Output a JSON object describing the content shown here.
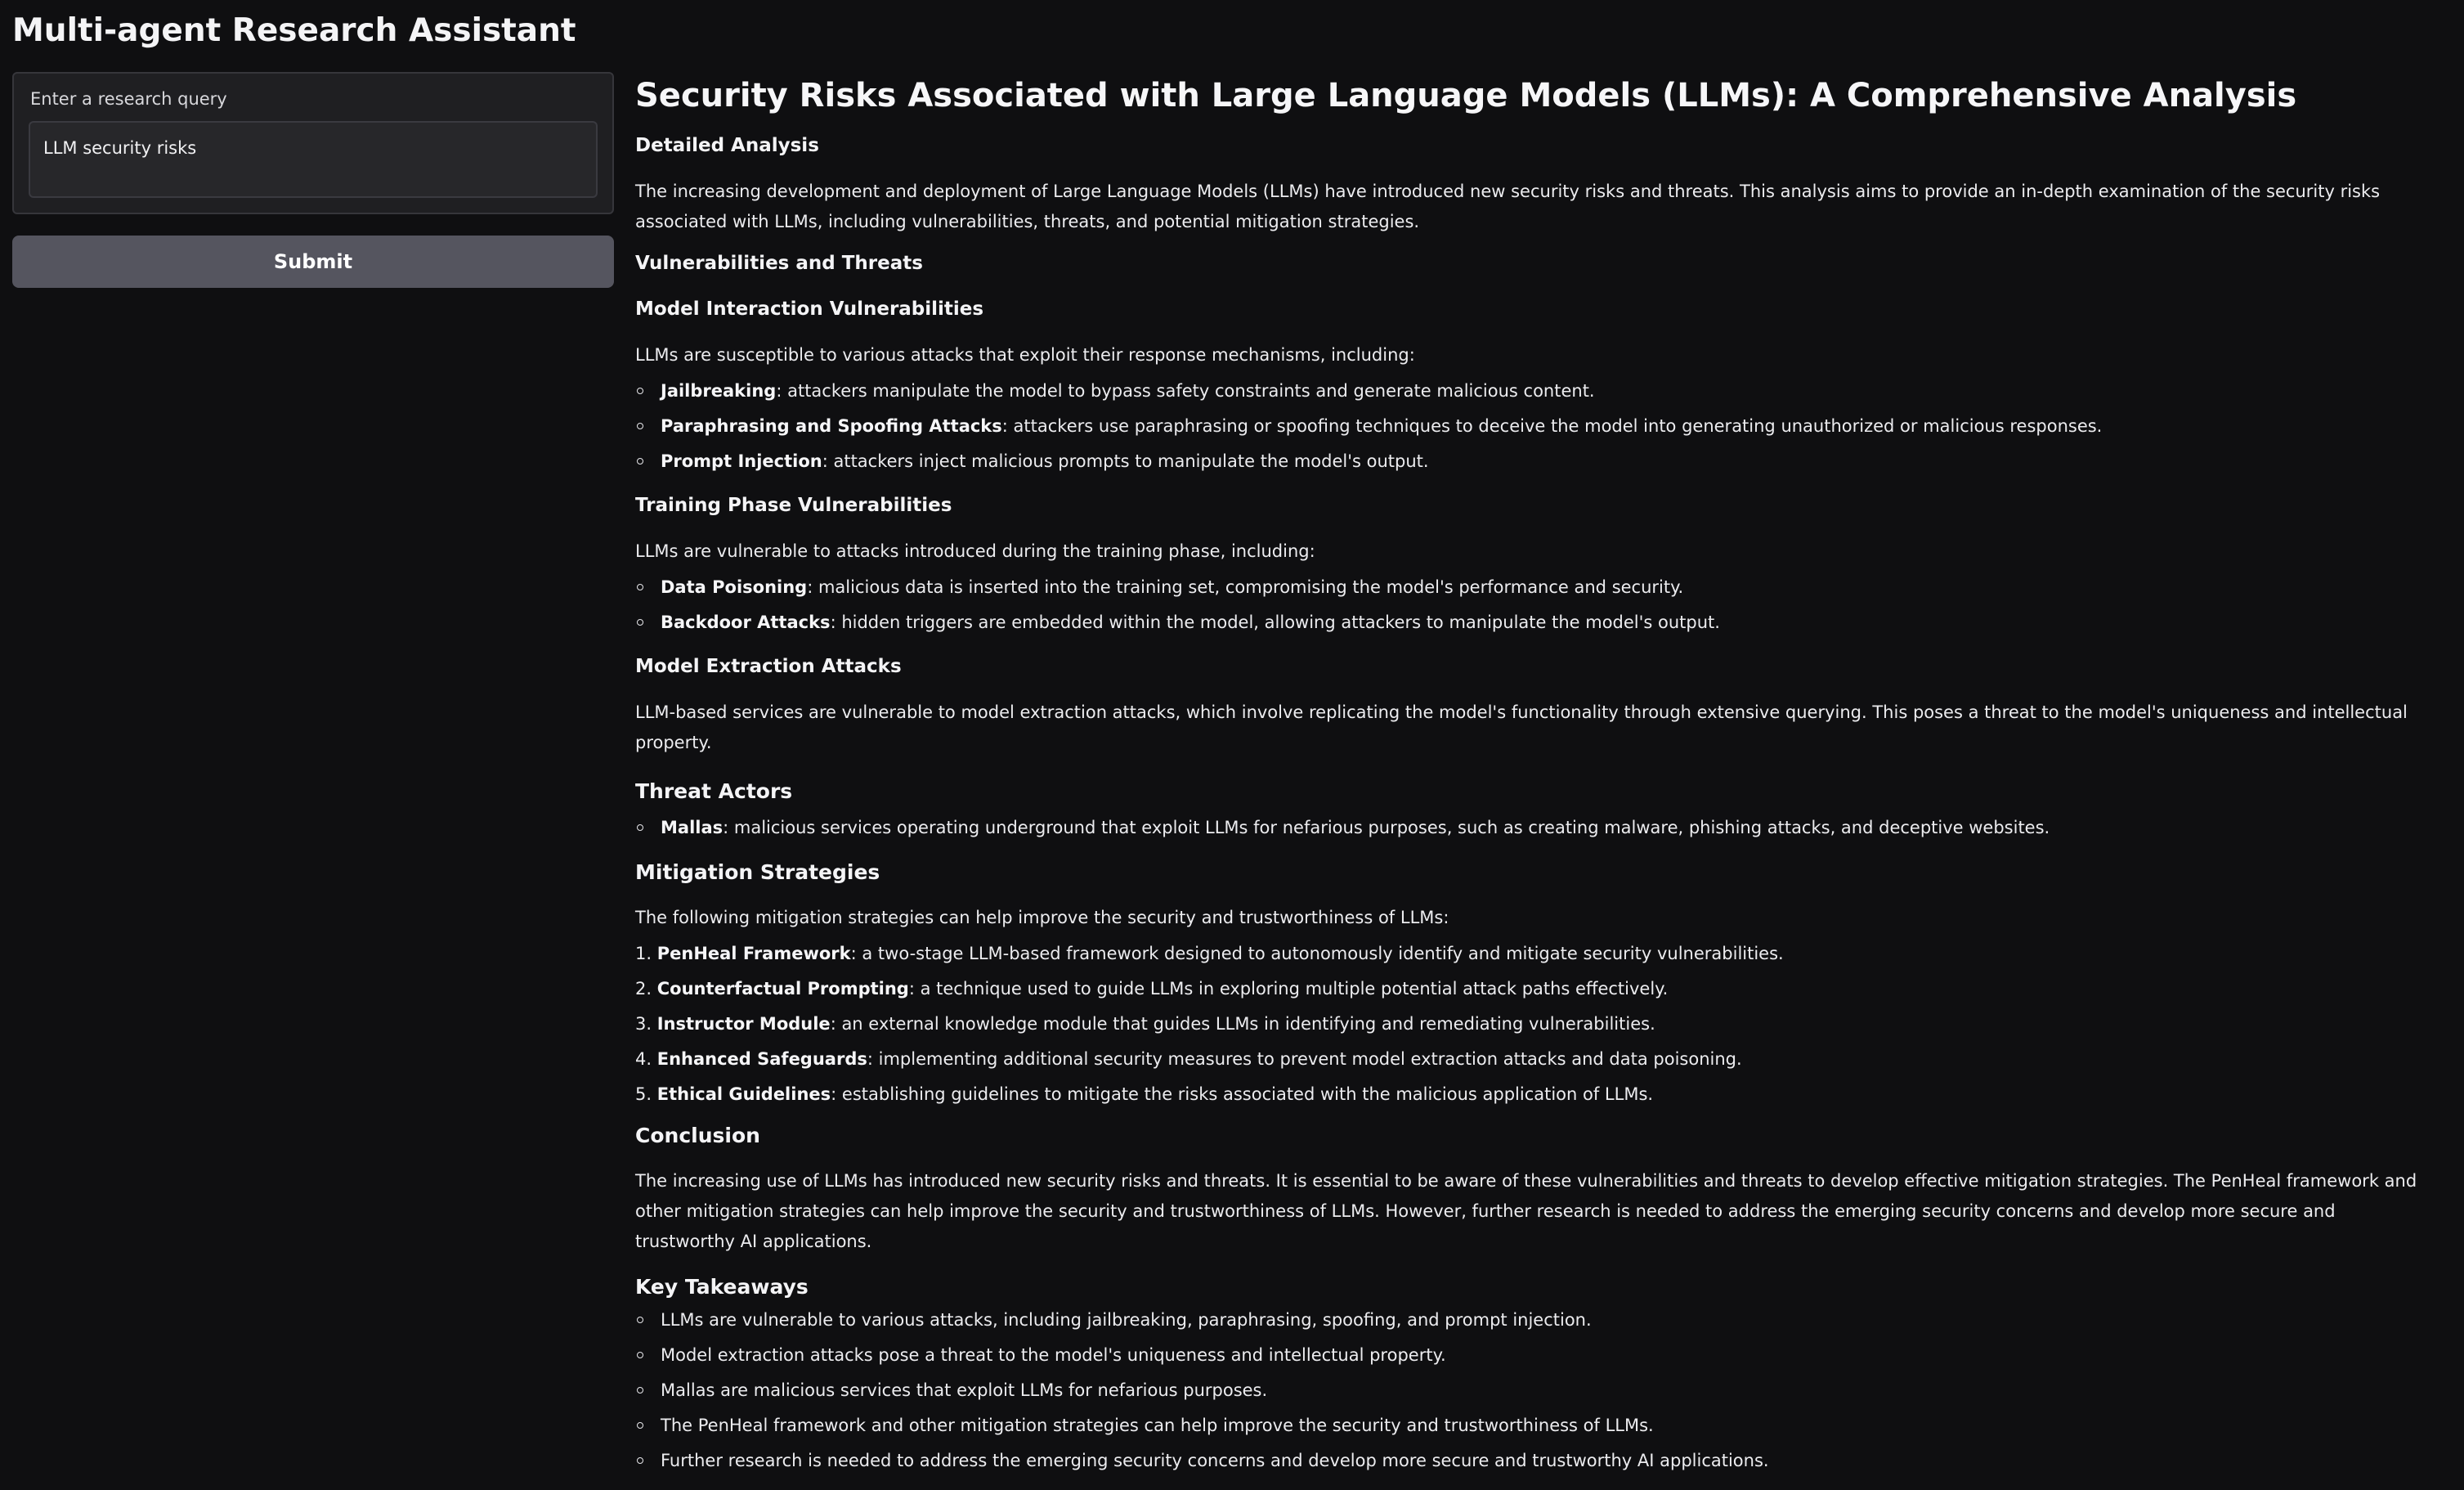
{
  "app": {
    "title": "Multi-agent Research Assistant"
  },
  "query": {
    "label": "Enter a research query",
    "value": "LLM security risks",
    "submit_label": "Submit"
  },
  "report": {
    "title": "Security Risks Associated with Large Language Models (LLMs): A Comprehensive Analysis",
    "detailed_heading": "Detailed Analysis",
    "intro": "The increasing development and deployment of Large Language Models (LLMs) have introduced new security risks and threats. This analysis aims to provide an in-depth examination of the security risks associated with LLMs, including vulnerabilities, threats, and potential mitigation strategies.",
    "vuln_heading": "Vulnerabilities and Threats",
    "model_interaction": {
      "heading": "Model Interaction Vulnerabilities",
      "intro": "LLMs are susceptible to various attacks that exploit their response mechanisms, including:",
      "items": [
        {
          "term": "Jailbreaking",
          "desc": ": attackers manipulate the model to bypass safety constraints and generate malicious content."
        },
        {
          "term": "Paraphrasing and Spoofing Attacks",
          "desc": ": attackers use paraphrasing or spoofing techniques to deceive the model into generating unauthorized or malicious responses."
        },
        {
          "term": "Prompt Injection",
          "desc": ": attackers inject malicious prompts to manipulate the model's output."
        }
      ]
    },
    "training_phase": {
      "heading": "Training Phase Vulnerabilities",
      "intro": "LLMs are vulnerable to attacks introduced during the training phase, including:",
      "items": [
        {
          "term": "Data Poisoning",
          "desc": ": malicious data is inserted into the training set, compromising the model's performance and security."
        },
        {
          "term": "Backdoor Attacks",
          "desc": ": hidden triggers are embedded within the model, allowing attackers to manipulate the model's output."
        }
      ]
    },
    "extraction": {
      "heading": "Model Extraction Attacks",
      "text": "LLM-based services are vulnerable to model extraction attacks, which involve replicating the model's functionality through extensive querying. This poses a threat to the model's uniqueness and intellectual property."
    },
    "threat_actors": {
      "heading": "Threat Actors",
      "items": [
        {
          "term": "Mallas",
          "desc": ": malicious services operating underground that exploit LLMs for nefarious purposes, such as creating malware, phishing attacks, and deceptive websites."
        }
      ]
    },
    "mitigation": {
      "heading": "Mitigation Strategies",
      "intro": "The following mitigation strategies can help improve the security and trustworthiness of LLMs:",
      "items": [
        {
          "num": "1.",
          "term": "PenHeal Framework",
          "desc": ": a two-stage LLM-based framework designed to autonomously identify and mitigate security vulnerabilities."
        },
        {
          "num": "2.",
          "term": "Counterfactual Prompting",
          "desc": ": a technique used to guide LLMs in exploring multiple potential attack paths effectively."
        },
        {
          "num": "3.",
          "term": "Instructor Module",
          "desc": ": an external knowledge module that guides LLMs in identifying and remediating vulnerabilities."
        },
        {
          "num": "4.",
          "term": "Enhanced Safeguards",
          "desc": ": implementing additional security measures to prevent model extraction attacks and data poisoning."
        },
        {
          "num": "5.",
          "term": "Ethical Guidelines",
          "desc": ": establishing guidelines to mitigate the risks associated with the malicious application of LLMs."
        }
      ]
    },
    "conclusion": {
      "heading": "Conclusion",
      "text": "The increasing use of LLMs has introduced new security risks and threats. It is essential to be aware of these vulnerabilities and threats to develop effective mitigation strategies. The PenHeal framework and other mitigation strategies can help improve the security and trustworthiness of LLMs. However, further research is needed to address the emerging security concerns and develop more secure and trustworthy AI applications."
    },
    "takeaways": {
      "heading": "Key Takeaways",
      "items": [
        "LLMs are vulnerable to various attacks, including jailbreaking, paraphrasing, spoofing, and prompt injection.",
        "Model extraction attacks pose a threat to the model's uniqueness and intellectual property.",
        "Mallas are malicious services that exploit LLMs for nefarious purposes.",
        "The PenHeal framework and other mitigation strategies can help improve the security and trustworthiness of LLMs.",
        "Further research is needed to address the emerging security concerns and develop more secure and trustworthy AI applications."
      ]
    }
  }
}
